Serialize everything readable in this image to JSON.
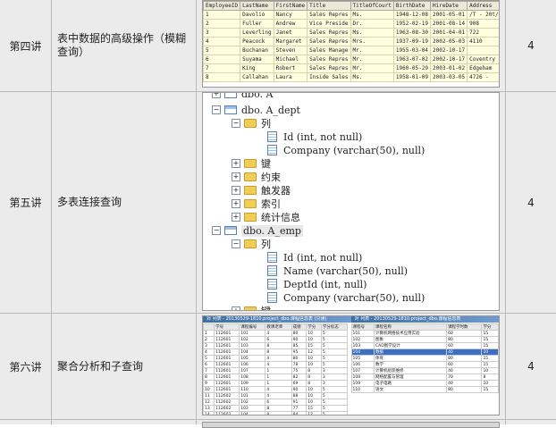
{
  "rows": [
    {
      "lesson": "第四讲",
      "topic": "表中数据的高级操作（模糊查询）",
      "hours": "4"
    },
    {
      "lesson": "第五讲",
      "topic": "多表连接查询",
      "hours": "4"
    },
    {
      "lesson": "第六讲",
      "topic": "聚合分析和子查询",
      "hours": "4"
    }
  ],
  "employees": {
    "headers": [
      "EmployeeID",
      "LastName",
      "FirstName",
      "Title",
      "TitleOfCourt",
      "BirthDate",
      "HireDate",
      "Address"
    ],
    "rows": [
      [
        "1",
        "Davolio",
        "Nancy",
        "Sales Repres",
        "Ms.",
        "1948-12-08",
        "2001-05-01",
        "/T - 20t/"
      ],
      [
        "2",
        "Fuller",
        "Andrew",
        "Vice Preside",
        "Dr.",
        "1952-02-19",
        "2001-08-14",
        "908"
      ],
      [
        "3",
        "Leverling",
        "Janet",
        "Sales Repres",
        "Ms.",
        "1963-08-30",
        "2001-04-01",
        "722"
      ],
      [
        "4",
        "Peacock",
        "Margaret",
        "Sales Repres",
        "Mrs.",
        "1937-09-19",
        "2002-05-03",
        "4110"
      ],
      [
        "5",
        "Buchanan",
        "Steven",
        "Sales Manage",
        "Mr.",
        "1955-03-04",
        "2002-10-17",
        ""
      ],
      [
        "6",
        "Suyama",
        "Michael",
        "Sales Repres",
        "Mr.",
        "1963-07-02",
        "2002-10-17",
        "Coventry"
      ],
      [
        "7",
        "King",
        "Robert",
        "Sales Repres",
        "Mr.",
        "1960-05-29",
        "2003-01-02",
        "Edgeham"
      ],
      [
        "8",
        "Callahan",
        "Laura",
        "Inside Sales",
        "Ms.",
        "1958-01-09",
        "2003-03-05",
        "4726 -"
      ]
    ]
  },
  "tree": {
    "partial_top": "dbo. A",
    "table1": "dbo. A_dept",
    "columns_label": "列",
    "dept_cols": [
      "Id (int, not null)",
      "Company (varchar(50), null)"
    ],
    "folders": [
      "键",
      "约束",
      "触发器",
      "索引",
      "统计信息"
    ],
    "table2": "dbo. A_emp",
    "emp_cols": [
      "Id (int, not null)",
      "Name (varchar(50), null)",
      "DeptId (int, null)",
      "Company (varchar(50), null)"
    ],
    "partial_bottom": "键"
  },
  "window": {
    "title_left": "对 列表 - 20130529-1810.project_dbo.课程信息表 (只读)",
    "title_right": "对 列表 - 20130529-1810.project_dbo.课程信息表",
    "left_headers": [
      "学号",
      "课程编号",
      "教课老师",
      "成绩",
      "学分",
      "学分标志"
    ],
    "left_rows": [
      [
        "1",
        "112601",
        "101",
        "4",
        "80",
        "10",
        "5"
      ],
      [
        "2",
        "112601",
        "102",
        "6",
        "90",
        "10",
        "5"
      ],
      [
        "3",
        "112601",
        "103",
        "8",
        "85",
        "15",
        "5"
      ],
      [
        "4",
        "112601",
        "104",
        "8",
        "95",
        "12",
        "5"
      ],
      [
        "5",
        "112601",
        "105",
        "4",
        "80",
        "10",
        "5"
      ],
      [
        "6",
        "112601",
        "106",
        "4",
        "78",
        "10",
        "5"
      ],
      [
        "7",
        "112601",
        "107",
        "1",
        "75",
        "8",
        "3"
      ],
      [
        "8",
        "112601",
        "108",
        "1",
        "82",
        "8",
        "3"
      ],
      [
        "9",
        "112601",
        "109",
        "1",
        "69",
        "8",
        "3"
      ],
      [
        "10",
        "112601",
        "110",
        "4",
        "90",
        "10",
        "5"
      ],
      [
        "11",
        "112602",
        "101",
        "4",
        "88",
        "10",
        "5"
      ],
      [
        "12",
        "112602",
        "102",
        "6",
        "91",
        "10",
        "5"
      ],
      [
        "13",
        "112602",
        "103",
        "8",
        "77",
        "15",
        "5"
      ],
      [
        "14",
        "112602",
        "104",
        "8",
        "84",
        "12",
        "5"
      ]
    ],
    "right_headers": [
      "课程号",
      "课程名称",
      "课程学时数",
      "学分"
    ],
    "right_rows": [
      [
        "101",
        "计算机网络技术应用实验",
        "60",
        "15"
      ],
      [
        "102",
        "图象",
        "80",
        "15"
      ],
      [
        "103",
        "CAD图学设计",
        "60",
        "15"
      ],
      [
        "104",
        "数据",
        "40",
        "10"
      ],
      [
        "105",
        "体育",
        "80",
        "15"
      ],
      [
        "106",
        "数学",
        "60",
        "15"
      ],
      [
        "107",
        "计算机组装维修",
        "40",
        "10"
      ],
      [
        "108",
        "网络配置与管理",
        "70",
        "8"
      ],
      [
        "109",
        "电子电路",
        "40",
        "10"
      ],
      [
        "110",
        "语文",
        "80",
        "15"
      ]
    ]
  }
}
